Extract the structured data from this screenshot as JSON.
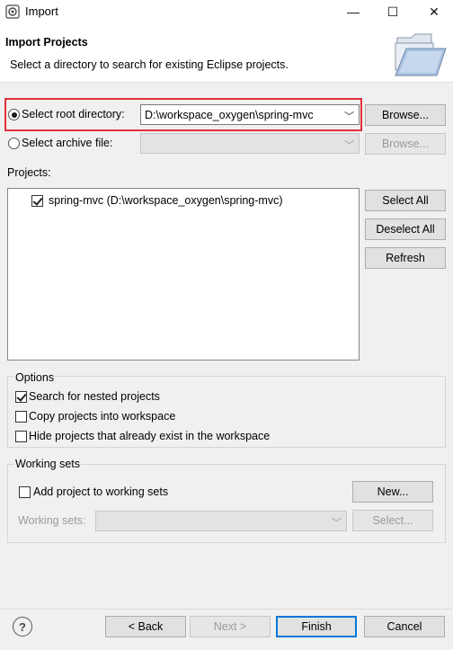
{
  "window": {
    "title": "Import",
    "minimize_glyph": "—",
    "maximize_glyph": "☐",
    "close_glyph": "✕"
  },
  "banner": {
    "title": "Import Projects",
    "description": "Select a directory to search for existing Eclipse projects."
  },
  "source": {
    "root_dir_label": "Select root directory:",
    "root_dir_value": "D:\\workspace_oxygen\\spring-mvc",
    "archive_label": "Select archive file:",
    "archive_value": "",
    "browse_label": "Browse...",
    "selected": "root_directory",
    "highlight_color": "#e0313b"
  },
  "projects": {
    "label": "Projects:",
    "items": [
      {
        "label": "spring-mvc (D:\\workspace_oxygen\\spring-mvc)",
        "checked": true
      }
    ],
    "select_all": "Select All",
    "deselect_all": "Deselect All",
    "refresh": "Refresh"
  },
  "options": {
    "legend": "Options",
    "search_nested": {
      "label": "Search for nested projects",
      "checked": true
    },
    "copy_projects": {
      "label": "Copy projects into workspace",
      "checked": false
    },
    "hide_existing": {
      "label": "Hide projects that already exist in the workspace",
      "checked": false
    }
  },
  "working_sets": {
    "legend": "Working sets",
    "add_label": "Add project to working sets",
    "add_checked": false,
    "new_button": "New...",
    "sets_label": "Working sets:",
    "select_button": "Select..."
  },
  "footer": {
    "help_glyph": "?",
    "back": "< Back",
    "next": "Next >",
    "finish": "Finish",
    "cancel": "Cancel",
    "accent_color": "#0078d7"
  }
}
